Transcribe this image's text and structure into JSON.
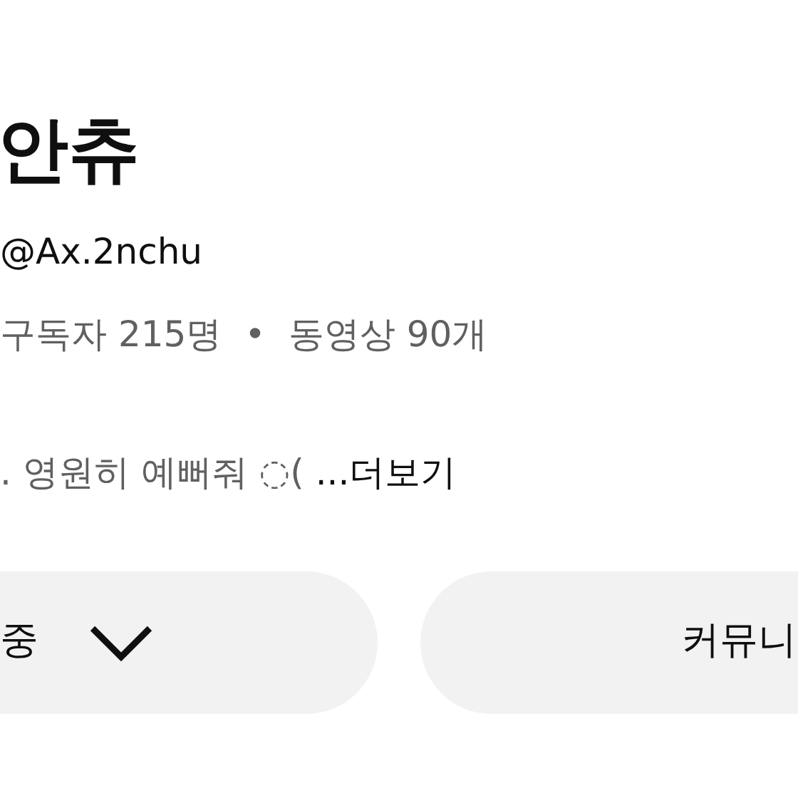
{
  "channel": {
    "name": "안츄",
    "handle": "@Ax.2nchu",
    "stats": [
      "구독자 215명",
      "동영상 90개"
    ],
    "separator": "•",
    "description": ". 영원히 예뻐줘 ◌(",
    "more_link": "...더보기"
  },
  "buttons": [
    {
      "label": "중",
      "kind": "dropdown"
    },
    {
      "label": "커뮤니",
      "kind": "plain"
    }
  ]
}
